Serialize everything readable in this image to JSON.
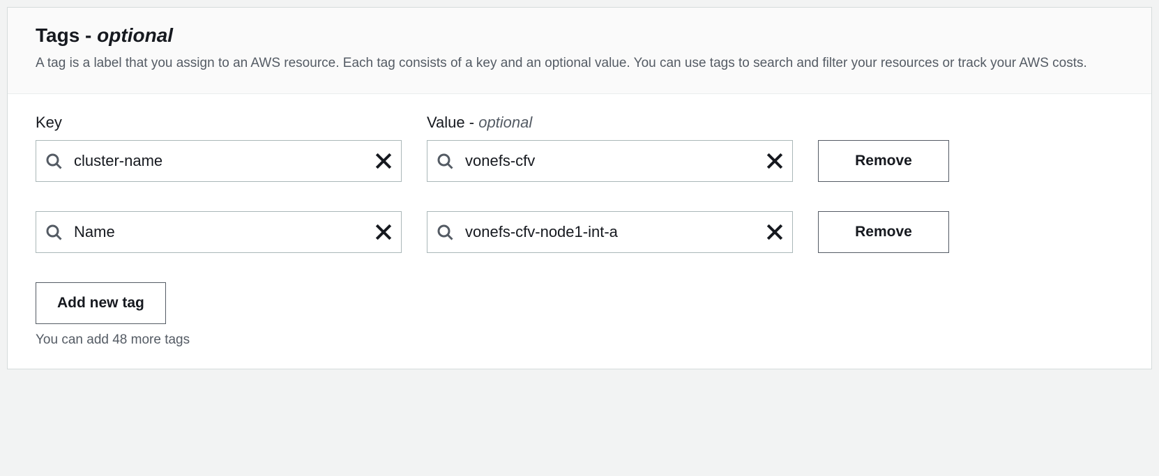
{
  "header": {
    "title_main": "Tags",
    "title_sep": " - ",
    "title_optional": "optional",
    "description": "A tag is a label that you assign to an AWS resource. Each tag consists of a key and an optional value. You can use tags to search and filter your resources or track your AWS costs."
  },
  "columns": {
    "key_label": "Key",
    "value_label": "Value",
    "value_sep": " - ",
    "value_optional": "optional"
  },
  "tags": [
    {
      "key": "cluster-name",
      "value": "vonefs-cfv"
    },
    {
      "key": "Name",
      "value": "vonefs-cfv-node1-int-a"
    }
  ],
  "actions": {
    "remove_label": "Remove",
    "add_label": "Add new tag",
    "remaining_text": "You can add 48 more tags"
  }
}
